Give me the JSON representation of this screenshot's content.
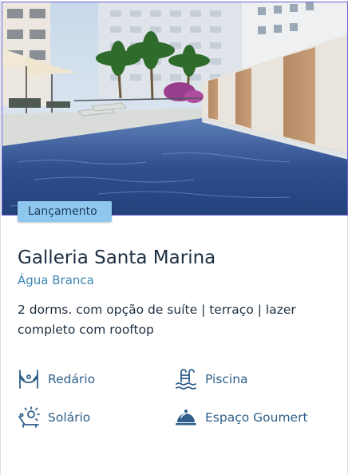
{
  "listing": {
    "badge": "Lançamento",
    "title": "Galleria Santa Marina",
    "location": "Água Branca",
    "description": "2 dorms. com opção de suíte | terraço | lazer completo com rooftop"
  },
  "amenities": [
    {
      "label": "Redário",
      "icon": "hammock-icon"
    },
    {
      "label": "Piscina",
      "icon": "pool-icon"
    },
    {
      "label": "Solário",
      "icon": "sunbed-icon"
    },
    {
      "label": "Espaço Goumert",
      "icon": "cloche-icon"
    }
  ],
  "colors": {
    "badge_bg": "#8ec8ef",
    "title": "#1d2f40",
    "location": "#3e86b4",
    "amenity_text": "#2f5f8a",
    "image_border": "#6b5fd0"
  }
}
